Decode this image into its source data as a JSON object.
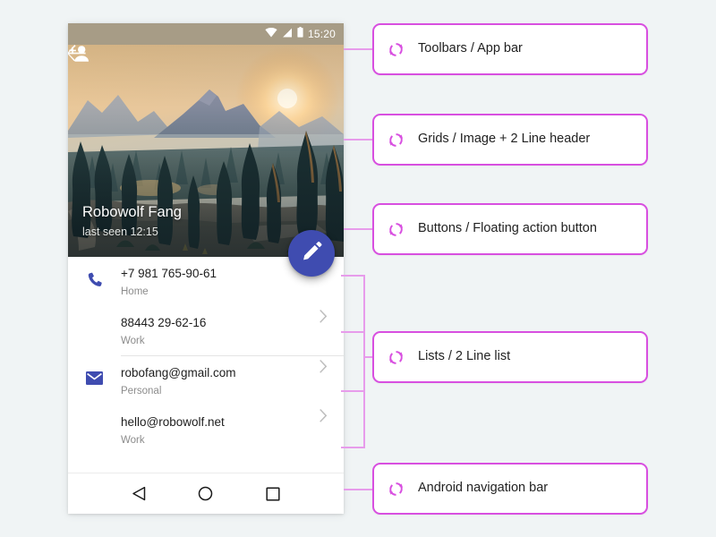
{
  "canvas": {
    "background": "#f0f4f5"
  },
  "phone": {
    "status_bar": {
      "time": "15:20",
      "icons": [
        "wifi-icon",
        "signal-icon",
        "battery-icon"
      ],
      "background": "#a79c86"
    },
    "app_bar": {
      "back_label": "Back",
      "back_icon": "arrow-back-icon",
      "add_person_icon": "person-add-icon",
      "add_person_label": "Add contact"
    },
    "hero": {
      "title": "Robowolf Fang",
      "subtitle": "last seen 12:15",
      "image_alt": "Sunset mountain forest landscape"
    },
    "fab": {
      "icon": "pencil-edit-icon",
      "label": "Edit",
      "color": "#3f4cb0"
    },
    "contacts": [
      {
        "icon": "phone-icon",
        "icon_color": "#3f4cb0",
        "primary": "+7 981 765-90-61",
        "secondary": "Home",
        "chevron": "chevron-right-icon"
      },
      {
        "icon": "",
        "icon_color": "",
        "primary": "88443 29-62-16",
        "secondary": "Work",
        "chevron": "chevron-right-icon"
      },
      {
        "icon": "email-icon",
        "icon_color": "#3f4cb0",
        "primary": "robofang@gmail.com",
        "secondary": "Personal",
        "chevron": "chevron-right-icon"
      },
      {
        "icon": "",
        "icon_color": "",
        "primary": "hello@robowolf.net",
        "secondary": "Work",
        "chevron": "chevron-right-icon"
      }
    ],
    "nav_bar": {
      "back_label": "Back",
      "home_label": "Home",
      "recents_label": "Recents"
    }
  },
  "annotations": {
    "icon": "sync-refresh-icon",
    "accent": "#d84fe0",
    "leader_color": "#e79ceb",
    "items": [
      {
        "label": "Toolbars / App bar"
      },
      {
        "label": "Grids / Image + 2 Line header"
      },
      {
        "label": "Buttons / Floating action button"
      },
      {
        "label": "Lists / 2 Line list"
      },
      {
        "label": "Android navigation bar"
      }
    ]
  }
}
